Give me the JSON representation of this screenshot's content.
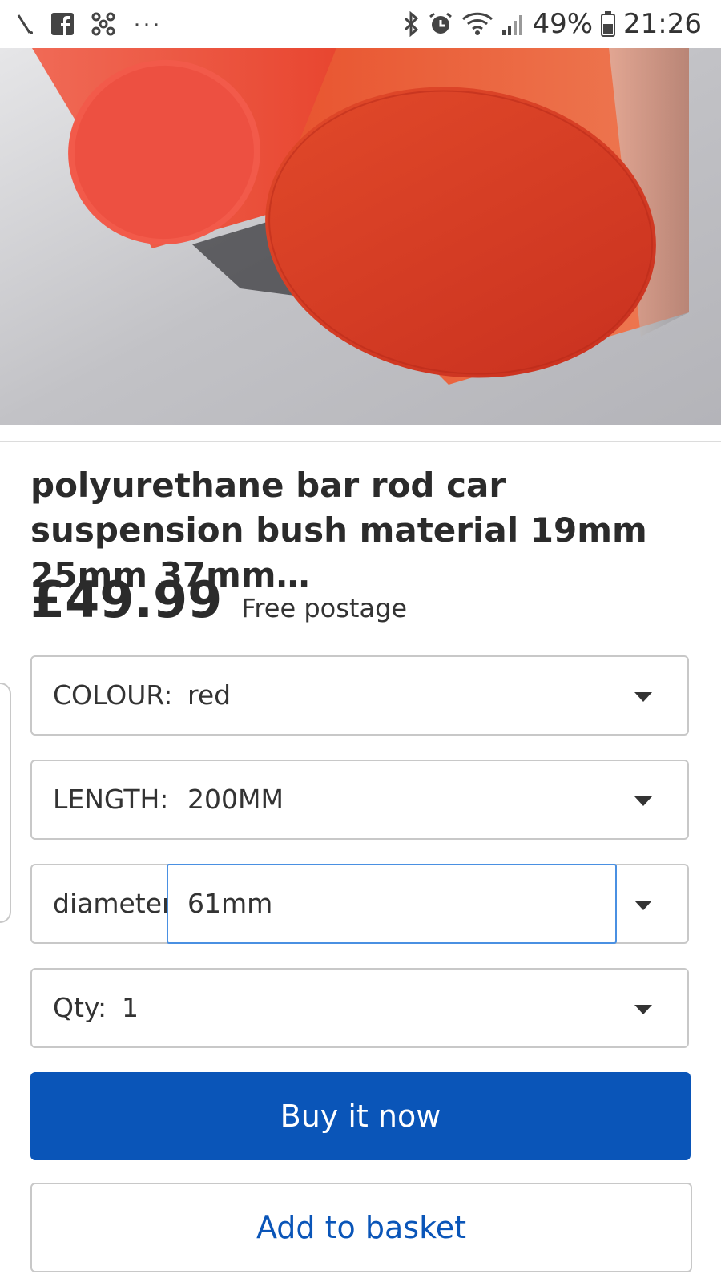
{
  "status_bar": {
    "left_icons": [
      "signal-slash-icon",
      "facebook-icon",
      "app-icon"
    ],
    "more": "···",
    "right_icons": [
      "bluetooth-icon",
      "alarm-icon",
      "wifi-icon",
      "cell-signal-icon"
    ],
    "battery": "49%",
    "time": "21:26"
  },
  "product": {
    "image_colors": {
      "rod": "#e7402f",
      "background": "#c9c9cd"
    },
    "title": "polyurethane bar rod car suspension bush material 19mm 25mm 37mm…",
    "price": "£49.99",
    "postage": "Free postage"
  },
  "options": {
    "colour": {
      "label": "COLOUR:",
      "value": "red"
    },
    "length": {
      "label": "LENGTH:",
      "value": "200MM"
    },
    "diameter": {
      "label": "diameter:",
      "value": "61mm"
    },
    "qty": {
      "label": "Qty:",
      "value": "1"
    }
  },
  "actions": {
    "buy_now": "Buy it now",
    "add_to_basket": "Add to basket"
  },
  "colors": {
    "primary": "#0a55b8",
    "focus": "#4a90e2"
  }
}
